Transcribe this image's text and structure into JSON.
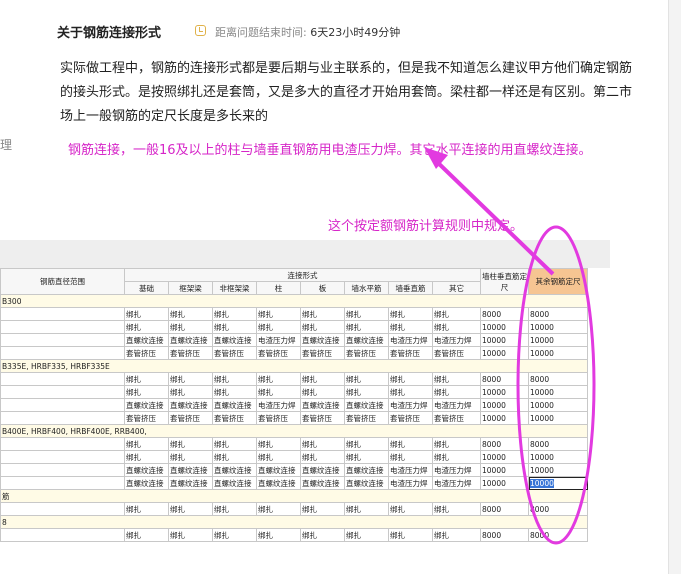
{
  "question": {
    "title": "关于钢筋连接形式",
    "remaining_label": "距离问题结束时间:",
    "remaining_value": "6天23小时49分钟",
    "body": "实际做工程中，钢筋的连接形式都是要后期与业主联系的，但是我不知道怎么建议甲方他们确定钢筋的接头形式。是按照绑扎还是套筒，又是多大的直径才开始用套筒。梁柱都一样还是有区别。第二市场上一般钢筋的定尺长度是多长来的",
    "clipped_left": "理"
  },
  "annotation": {
    "answer": "钢筋连接，一般16及以上的柱与墙垂直钢筋用电渣压力焊。其它水平连接的用直螺纹连接。",
    "note": "这个按定额钢筋计算规则中规定。",
    "color": "#d626c8"
  },
  "table": {
    "range_header": "钢筋直径范围",
    "group_header": "连接形式",
    "columns": [
      "基础",
      "框架梁",
      "非框架梁",
      "柱",
      "板",
      "墙水平筋",
      "墙垂直筋",
      "其它"
    ],
    "vertical_length_header": "墙柱垂直筋定尺",
    "other_length_header": "其余钢筋定尺",
    "rows": [
      {
        "group": true,
        "label": "B300"
      },
      {
        "cells": [
          "绑扎",
          "绑扎",
          "绑扎",
          "绑扎",
          "绑扎",
          "绑扎",
          "绑扎",
          "绑扎"
        ],
        "v": "8000",
        "o": "8000"
      },
      {
        "cells": [
          "绑扎",
          "绑扎",
          "绑扎",
          "绑扎",
          "绑扎",
          "绑扎",
          "绑扎",
          "绑扎"
        ],
        "v": "10000",
        "o": "10000"
      },
      {
        "cells": [
          "直螺纹连接",
          "直螺纹连接",
          "直螺纹连接",
          "电渣压力焊",
          "直螺纹连接",
          "直螺纹连接",
          "电渣压力焊",
          "电渣压力焊"
        ],
        "v": "10000",
        "o": "10000"
      },
      {
        "cells": [
          "套管挤压",
          "套管挤压",
          "套管挤压",
          "套管挤压",
          "套管挤压",
          "套管挤压",
          "套管挤压",
          "套管挤压"
        ],
        "v": "10000",
        "o": "10000"
      },
      {
        "group": true,
        "label": "B335E, HRBF335, HRBF335E"
      },
      {
        "cells": [
          "绑扎",
          "绑扎",
          "绑扎",
          "绑扎",
          "绑扎",
          "绑扎",
          "绑扎",
          "绑扎"
        ],
        "v": "8000",
        "o": "8000"
      },
      {
        "cells": [
          "绑扎",
          "绑扎",
          "绑扎",
          "绑扎",
          "绑扎",
          "绑扎",
          "绑扎",
          "绑扎"
        ],
        "v": "10000",
        "o": "10000"
      },
      {
        "cells": [
          "直螺纹连接",
          "直螺纹连接",
          "直螺纹连接",
          "电渣压力焊",
          "直螺纹连接",
          "直螺纹连接",
          "电渣压力焊",
          "电渣压力焊"
        ],
        "v": "10000",
        "o": "10000"
      },
      {
        "cells": [
          "套管挤压",
          "套管挤压",
          "套管挤压",
          "套管挤压",
          "套管挤压",
          "套管挤压",
          "套管挤压",
          "套管挤压"
        ],
        "v": "10000",
        "o": "10000"
      },
      {
        "group": true,
        "label": "B400E, HRBF400, HRBF400E, RRB400,"
      },
      {
        "cells": [
          "绑扎",
          "绑扎",
          "绑扎",
          "绑扎",
          "绑扎",
          "绑扎",
          "绑扎",
          "绑扎"
        ],
        "v": "8000",
        "o": "8000"
      },
      {
        "cells": [
          "绑扎",
          "绑扎",
          "绑扎",
          "绑扎",
          "绑扎",
          "绑扎",
          "绑扎",
          "绑扎"
        ],
        "v": "10000",
        "o": "10000"
      },
      {
        "cells": [
          "直螺纹连接",
          "直螺纹连接",
          "直螺纹连接",
          "直螺纹连接",
          "直螺纹连接",
          "直螺纹连接",
          "电渣压力焊",
          "电渣压力焊"
        ],
        "v": "10000",
        "o": "10000"
      },
      {
        "cells": [
          "直螺纹连接",
          "直螺纹连接",
          "直螺纹连接",
          "直螺纹连接",
          "直螺纹连接",
          "直螺纹连接",
          "电渣压力焊",
          "电渣压力焊"
        ],
        "v": "10000",
        "o": "10000",
        "selected": true
      },
      {
        "group": true,
        "label": "筋"
      },
      {
        "cells": [
          "绑扎",
          "绑扎",
          "绑扎",
          "绑扎",
          "绑扎",
          "绑扎",
          "绑扎",
          "绑扎"
        ],
        "v": "8000",
        "o": "8000"
      },
      {
        "group": true,
        "label": "8"
      },
      {
        "cells": [
          "绑扎",
          "绑扎",
          "绑扎",
          "绑扎",
          "绑扎",
          "绑扎",
          "绑扎",
          "绑扎"
        ],
        "v": "8000",
        "o": "8000"
      }
    ]
  }
}
